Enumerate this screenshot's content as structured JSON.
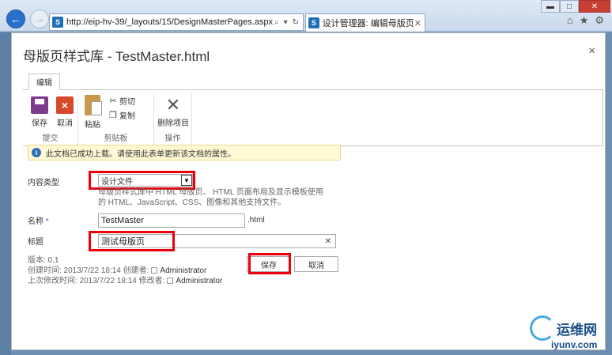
{
  "browser": {
    "url": "http://eip-hv-39/_layouts/15/DesignMasterPages.aspx",
    "tab_title": "设计管理器: 编辑母版页",
    "sp_logo_text": "S"
  },
  "dialog": {
    "title": "母版页样式库 - TestMaster.html",
    "close_glyph": "×"
  },
  "ribbon": {
    "tab_label": "编辑",
    "groups": {
      "commit": {
        "label": "提交",
        "save": "保存",
        "cancel": "取消"
      },
      "clipboard": {
        "label": "剪贴板",
        "paste": "粘贴",
        "cut": "剪切",
        "copy": "复制"
      },
      "actions": {
        "label": "操作",
        "delete": "删除项目"
      }
    }
  },
  "status": {
    "message": "此文档已成功上载。请使用此表单更新该文档的属性。"
  },
  "form": {
    "content_type": {
      "label": "内容类型",
      "value": "设计文件",
      "description": "母版页样式库中 HTML 母版页、 HTML 页面布局及显示模板使用的 HTML、JavaScript、CSS、图像和其他支持文件。"
    },
    "name": {
      "label": "名称",
      "required_mark": "*",
      "value": "TestMaster",
      "suffix": ".html"
    },
    "title": {
      "label": "标题",
      "value": "测试母版页"
    }
  },
  "meta": {
    "version": "版本: 0.1",
    "created": "创建时间: 2013/7/22 18:14  创建者:",
    "created_by": "Administrator",
    "modified": "上次修改时间: 2013/7/22 18:14  修改者:",
    "modified_by": "Administrator"
  },
  "buttons": {
    "save": "保存",
    "cancel": "取消"
  },
  "watermark": {
    "main": "运维网",
    "sub": "iyunv.com"
  },
  "colors": {
    "accent": "#2a6fc9",
    "highlight": "#e8000c",
    "status_bg": "#fff9d6"
  }
}
